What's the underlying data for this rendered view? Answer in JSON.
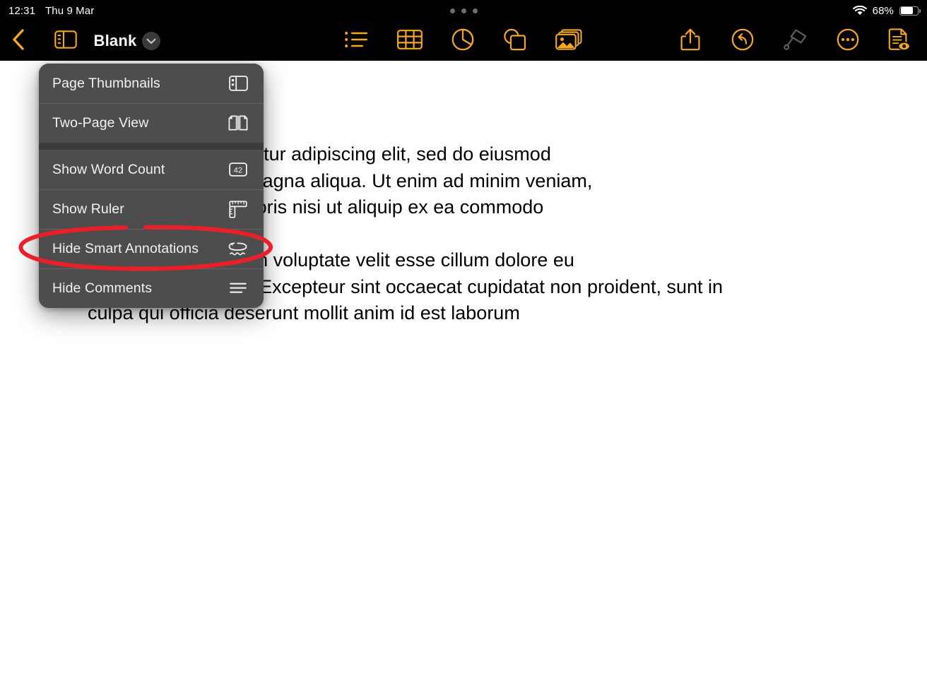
{
  "status_bar": {
    "time": "12:31",
    "date": "Thu 9 Mar",
    "battery_percent": "68%",
    "battery_level": 68,
    "wifi_icon": "wifi-icon",
    "battery_icon": "battery-icon",
    "multitask_handle_icon": "multitask-dots-icon"
  },
  "toolbar": {
    "back_icon": "back-chevron-icon",
    "view_options_icon": "document-view-sidebar-icon",
    "document_title": "Blank",
    "title_menu_icon": "chevron-down-circle-icon",
    "center_tools": [
      {
        "name": "insert-list-button",
        "icon": "bulleted-list-icon"
      },
      {
        "name": "insert-table-button",
        "icon": "table-icon"
      },
      {
        "name": "insert-chart-button",
        "icon": "pie-chart-icon"
      },
      {
        "name": "insert-shape-button",
        "icon": "shapes-icon"
      },
      {
        "name": "insert-media-button",
        "icon": "photo-media-icon"
      }
    ],
    "right_tools": [
      {
        "name": "share-button",
        "icon": "share-upload-icon",
        "enabled": true
      },
      {
        "name": "undo-button",
        "icon": "undo-arrow-icon",
        "enabled": true
      },
      {
        "name": "format-brush-button",
        "icon": "paint-brush-icon",
        "enabled": false
      },
      {
        "name": "more-options-button",
        "icon": "ellipsis-circle-icon",
        "enabled": true
      },
      {
        "name": "document-options-button",
        "icon": "document-eye-icon",
        "enabled": true
      }
    ],
    "accent_color": "#F5A623",
    "disabled_color": "#5c5c5c",
    "background_color": "#000000"
  },
  "view_menu": {
    "background_color": "#4d4d4d",
    "groups": [
      {
        "items": [
          {
            "label": "Page Thumbnails",
            "icon": "page-thumbnails-icon"
          },
          {
            "label": "Two-Page View",
            "icon": "two-page-view-icon"
          }
        ]
      },
      {
        "items": [
          {
            "label": "Show Word Count",
            "icon": "word-count-42-icon",
            "badge": "42"
          },
          {
            "label": "Show Ruler",
            "icon": "ruler-icon"
          },
          {
            "label": "Hide Smart Annotations",
            "icon": "smart-annotation-icon"
          },
          {
            "label": "Hide Comments",
            "icon": "comments-lines-icon"
          }
        ]
      }
    ]
  },
  "annotation": {
    "shape": "ellipse",
    "color": "#E8202A",
    "stroke_width": 6,
    "targets": "Hide Smart Annotations"
  },
  "document": {
    "paragraph_lines": [
      "or sit amet, consectetur adipiscing elit, sed do eiusmod",
      "ut labore et dolore magna aliqua. Ut enim ad minim veniam,",
      "rcitation ullamco laboris nisi ut aliquip ex ea commodo",
      "lor in reprehenderit in voluptate velit esse cillum dolore eu",
      "fugiat nulla pariatur. Excepteur sint occaecat cupidatat non proident, sunt in",
      "culpa qui officia deserunt mollit anim id est laborum"
    ],
    "text_color": "#000000",
    "background_color": "#ffffff"
  }
}
